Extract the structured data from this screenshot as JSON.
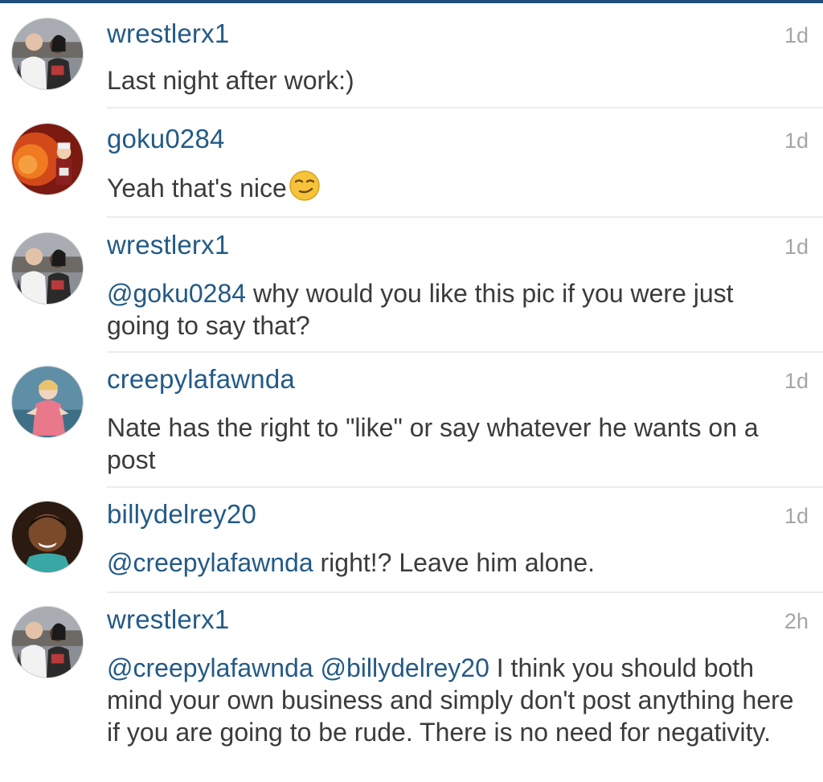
{
  "comments": [
    {
      "username": "wrestlerx1",
      "time": "1d",
      "text": "Last night after work:)",
      "avatar_icon": "couple-photo-avatar"
    },
    {
      "username": "goku0284",
      "time": "1d",
      "text": "Yeah that's nice",
      "emoji": "smirking-face-emoji",
      "avatar_icon": "anime-character-avatar"
    },
    {
      "username": "wrestlerx1",
      "time": "1d",
      "mention": "@goku0284",
      "text": " why would you like this pic if you were just going to say that?",
      "avatar_icon": "couple-photo-avatar"
    },
    {
      "username": "creepylafawnda",
      "time": "1d",
      "text": "Nate has the right to \"like\" or say whatever he wants on a post",
      "avatar_icon": "doll-photo-avatar"
    },
    {
      "username": "billydelrey20",
      "time": "1d",
      "mention": "@creepylafawnda",
      "text": " right!? Leave him alone.",
      "avatar_icon": "person-selfie-avatar"
    },
    {
      "username": "wrestlerx1",
      "time": "2h",
      "mention": "@creepylafawnda",
      "mention2": "@billydelrey20",
      "text": " I think you should both mind your own business and simply don't post anything here if you are going to be rude. There is no need for negativity.",
      "avatar_icon": "couple-photo-avatar"
    }
  ],
  "colors": {
    "username": "#235a86",
    "text": "#3b3b3b",
    "time": "#a5a5a5",
    "divider": "#ececec",
    "topbar": "#1f4e7a"
  }
}
